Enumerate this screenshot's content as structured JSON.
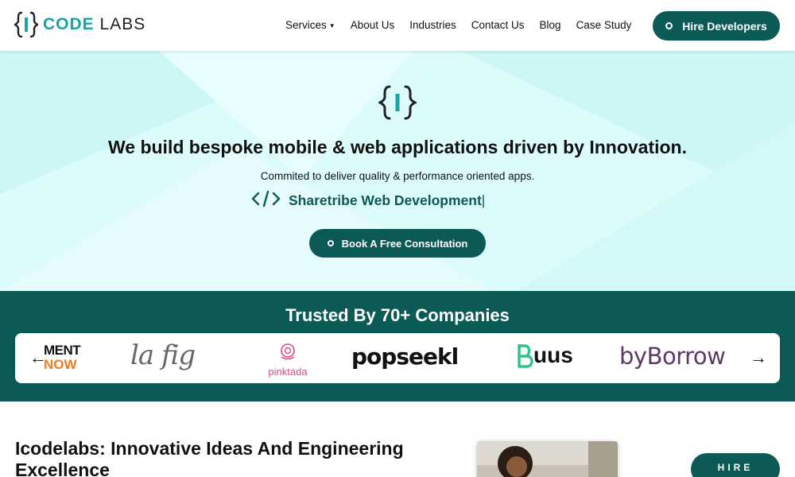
{
  "brand": {
    "code": "CODE",
    "labs": "LABS"
  },
  "nav": {
    "items": [
      {
        "label": "Services"
      },
      {
        "label": "About Us"
      },
      {
        "label": "Industries"
      },
      {
        "label": "Contact Us"
      },
      {
        "label": "Blog"
      },
      {
        "label": "Case Study"
      }
    ],
    "cta": "Hire Developers"
  },
  "hero": {
    "title": "We build bespoke mobile & web applications driven by Innovation.",
    "subtitle": "Commited to deliver quality & performance oriented apps.",
    "typing_text": "Sharetribe Web Development",
    "cursor": "|",
    "cta": "Book A Free Consultation"
  },
  "trusted": {
    "title": "Trusted By 70+ Companies",
    "logos": [
      {
        "line1": "MENT",
        "line2": "NOW"
      },
      {
        "name": "la fig"
      },
      {
        "name": "pinktada"
      },
      {
        "name": "popseekl"
      },
      {
        "name": "uus"
      },
      {
        "name": "byBorrow"
      }
    ]
  },
  "about": {
    "title": "Icodelabs: Innovative Ideas And Engineering Excellence",
    "cta": "HIRE"
  },
  "colors": {
    "primary": "#0c5a55",
    "accent": "#1aa3a3",
    "hero_bg": "#dcfbfb",
    "now_orange": "#f07a1e",
    "pinktada": "#e0478a"
  },
  "icons": [
    "brackets-logo-icon",
    "caret-down-icon",
    "code-tag-icon",
    "arrow-left-icon",
    "arrow-right-icon"
  ]
}
